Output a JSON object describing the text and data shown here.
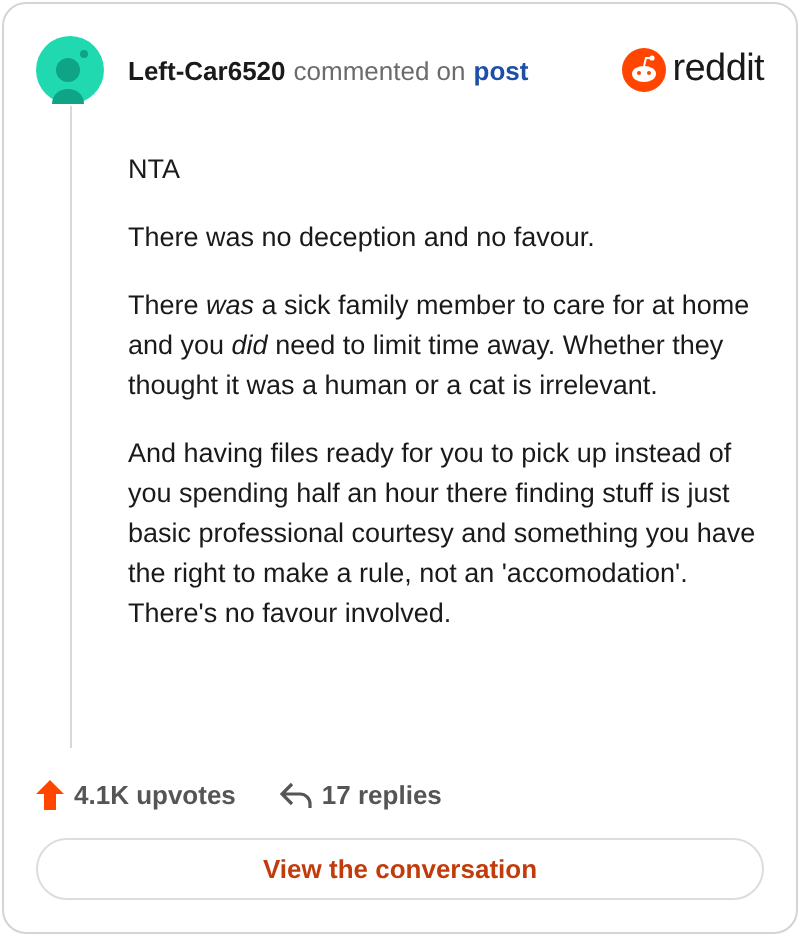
{
  "header": {
    "author": "Left-Car6520",
    "action": "commented on",
    "link": "post",
    "brand": "reddit"
  },
  "paragraphs": [
    "NTA",
    "There was no deception and no favour.",
    "There *was* a sick family member to care for at home and you *did* need to limit time away. Whether they thought it was a human or a cat is irrelevant.",
    "And having files ready for you to pick up instead of you spending half an hour there finding stuff is just basic professional courtesy and something you have the right to make a rule, not an 'accomodation'. There's no favour involved."
  ],
  "footer": {
    "upvotes": "4.1K upvotes",
    "replies": "17 replies"
  },
  "button": "View the conversation"
}
